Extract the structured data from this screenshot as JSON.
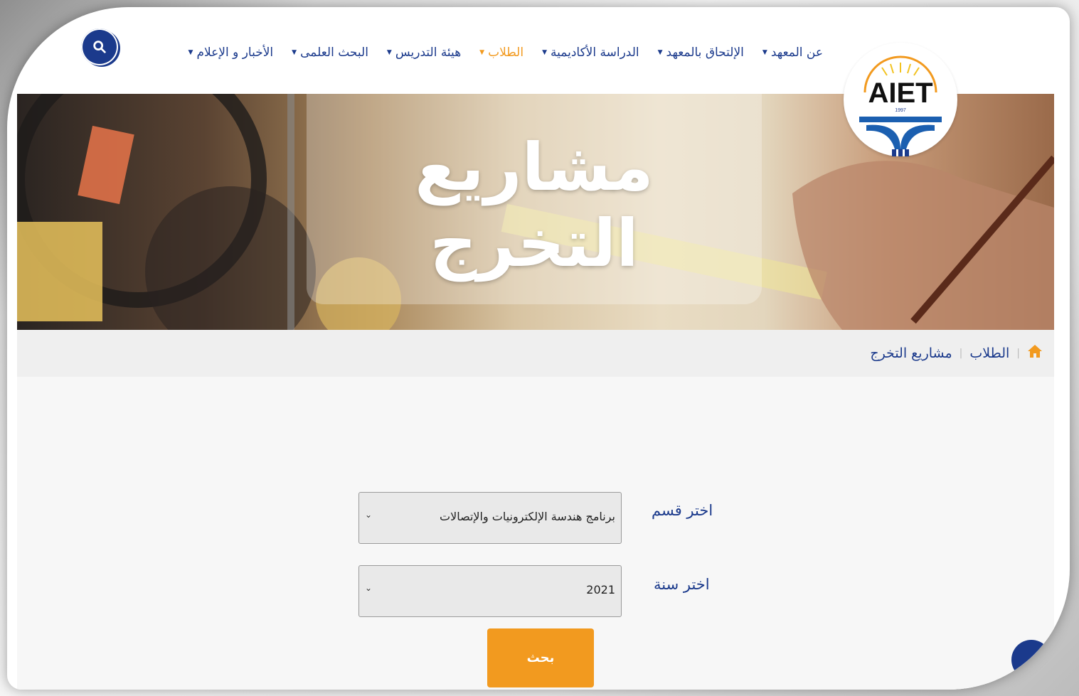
{
  "header": {
    "nav": [
      {
        "label": "عن المعهد",
        "active": false
      },
      {
        "label": "الإلتحاق بالمعهد",
        "active": false
      },
      {
        "label": "الدراسة الأكاديمية",
        "active": false
      },
      {
        "label": "الطلاب",
        "active": true
      },
      {
        "label": "هيئة التدريس",
        "active": false
      },
      {
        "label": "البحث العلمى",
        "active": false
      },
      {
        "label": "الأخبار و الإعلام",
        "active": false
      }
    ],
    "search_icon": "search-icon"
  },
  "logo": {
    "text": "AIET",
    "year": "1997"
  },
  "hero": {
    "title": "مشاريع التخرج"
  },
  "breadcrumb": {
    "home_icon": "home-icon",
    "section": "الطلاب",
    "current": "مشاريع التخرج"
  },
  "form": {
    "department_label": "اختر قسم",
    "department_value": "برنامج هندسة الإلكترونيات والإتصالات",
    "year_label": "اختر سنة",
    "year_value": "2021",
    "search_button": "بحث"
  },
  "colors": {
    "brand_blue": "#1b3a8c",
    "accent_orange": "#f29a1f"
  }
}
